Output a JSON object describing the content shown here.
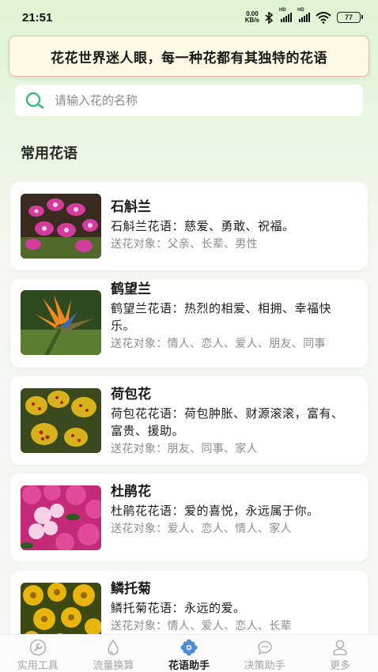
{
  "status": {
    "time": "21:51",
    "net_speed_value": "0.00",
    "net_speed_unit": "KB/s",
    "sim1_tag": "HD",
    "sim2_tag": "HD",
    "battery": "77"
  },
  "banner": {
    "text": "花花世界迷人眼，每一种花都有其独特的花语"
  },
  "search": {
    "placeholder": "请输入花的名称",
    "value": ""
  },
  "section": {
    "title": "常用花语"
  },
  "flowers": [
    {
      "name": "石斛兰",
      "meaning": "石斛兰花语：慈爱、勇敢、祝福。",
      "target": "送花对象：父亲、长辈、男性"
    },
    {
      "name": "鹤望兰",
      "meaning": "鹤望兰花语：热烈的相爱、相拥、幸福快乐。",
      "target": "送花对象：情人、恋人、爱人、朋友、同事"
    },
    {
      "name": "荷包花",
      "meaning": "荷包花花语：荷包肿胀、财源滚滚，富有、富贵、援助。",
      "target": "送花对象：朋友、同事、家人"
    },
    {
      "name": "杜鹃花",
      "meaning": "杜鹃花花语：爱的喜悦，永远属于你。",
      "target": "送花对象：爱人、恋人、情人、家人"
    },
    {
      "name": "鳞托菊",
      "meaning": "鳞托菊花语：永远的爱。",
      "target": "送花对象：情人、爱人、恋人、长辈"
    }
  ],
  "tabs": [
    {
      "label": "实用工具",
      "icon": "wrench-icon"
    },
    {
      "label": "流量换算",
      "icon": "water-drop-icon"
    },
    {
      "label": "花语助手",
      "icon": "flower-icon",
      "active": true
    },
    {
      "label": "决策助手",
      "icon": "chat-bubble-icon"
    },
    {
      "label": "更多",
      "icon": "person-icon"
    }
  ],
  "colors": {
    "accent_green": "#3dbb7a",
    "tab_active": "#4a8fd6",
    "banner_bg": "#fff8e4",
    "banner_border": "#e8b6a4"
  }
}
